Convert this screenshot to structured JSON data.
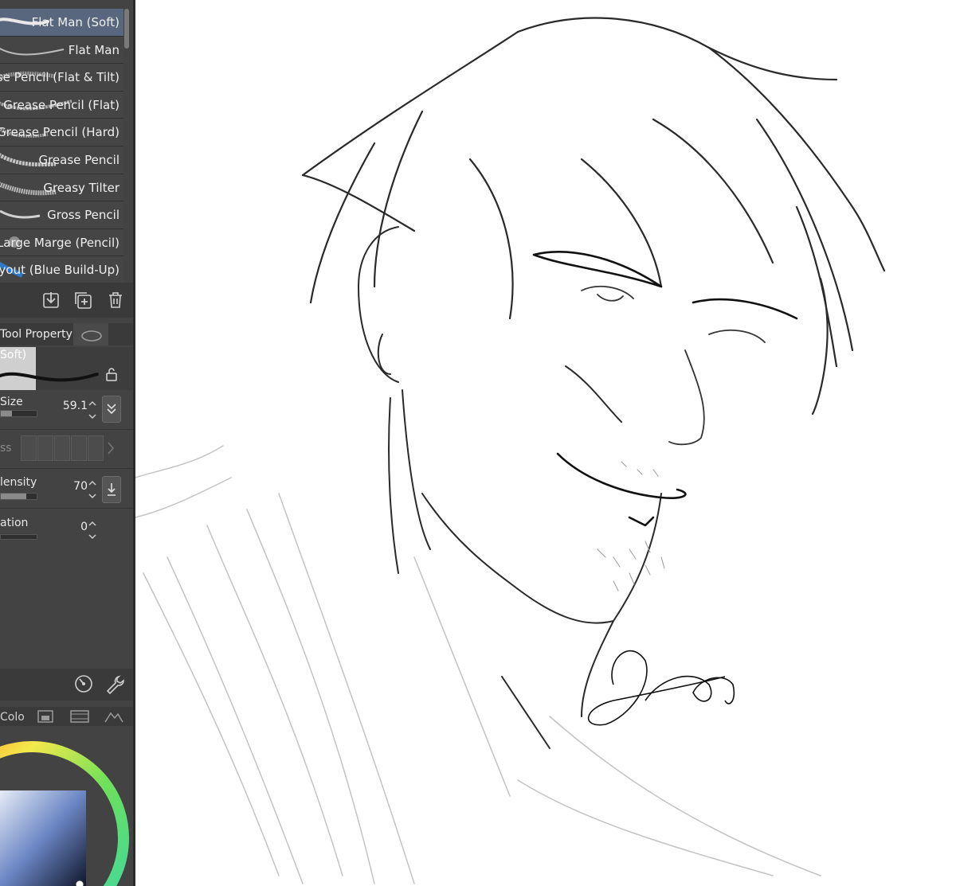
{
  "brushes": {
    "items": [
      {
        "label": "Flat Man (Soft)",
        "selected": true
      },
      {
        "label": "Flat Man",
        "selected": false
      },
      {
        "label": "ease Pencil (Flat & Tilt)",
        "selected": false
      },
      {
        "label": "Grease Pencil (Flat)",
        "selected": false
      },
      {
        "label": "Grease Pencil (Hard)",
        "selected": false
      },
      {
        "label": "Grease Pencil",
        "selected": false
      },
      {
        "label": "Greasy Tilter",
        "selected": false
      },
      {
        "label": "Gross Pencil",
        "selected": false
      },
      {
        "label": "Large Marge (Pencil)",
        "selected": false
      },
      {
        "label": "Layout (Blue Build-Up)",
        "selected": false
      }
    ],
    "selected_color": "#58677d"
  },
  "tool_property": {
    "tab_label": "Tool Property",
    "preview_name": "Soft)",
    "size": {
      "label": "Size",
      "value": "59.1",
      "level": 0.3
    },
    "hardness": {
      "label": "ss"
    },
    "density": {
      "label": "lensity",
      "value": "70",
      "level": 0.7
    },
    "stabilization": {
      "label": "ation",
      "value": "0",
      "level": 0
    }
  },
  "color_panel": {
    "tab_label": "Colo",
    "blue": "#2a55d6"
  },
  "canvas": {
    "signature": "Brooklyn"
  }
}
